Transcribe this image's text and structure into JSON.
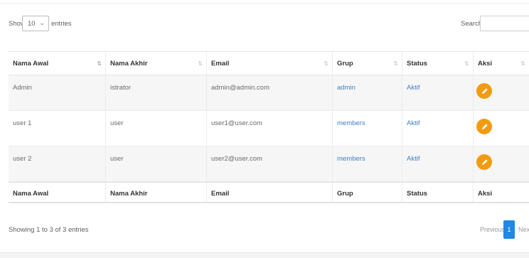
{
  "controls": {
    "show_label": "Show",
    "page_size": "10",
    "entries_label": "entries",
    "search_label": "Search:",
    "search_value": ""
  },
  "table": {
    "headers": [
      "Nama Awal",
      "Nama Akhir",
      "Email",
      "Grup",
      "Status",
      "Aksi"
    ],
    "rows": [
      [
        "Admin",
        "istrator",
        "admin@admin.com",
        "admin",
        "Aktif"
      ],
      [
        "user 1",
        "user",
        "user1@user.com",
        "members",
        "Aktif"
      ],
      [
        "user 2",
        "user",
        "user2@user.com",
        "members",
        "Aktif"
      ]
    ],
    "footers": [
      "Nama Awal",
      "Nama Akhir",
      "Email",
      "Grup",
      "Status",
      "Aksi"
    ]
  },
  "info": "Showing 1 to 3 of 3 entries",
  "pagination": {
    "previous": "Previous",
    "current_page": "1",
    "next": "Next"
  },
  "colors": {
    "accent": "#1e88e5",
    "link": "#3f7fc1",
    "edit_button": "#f29b12"
  },
  "icons": {
    "sort": "sort-arrows-icon",
    "edit": "pencil-icon",
    "select": "chevron-down-icon"
  }
}
